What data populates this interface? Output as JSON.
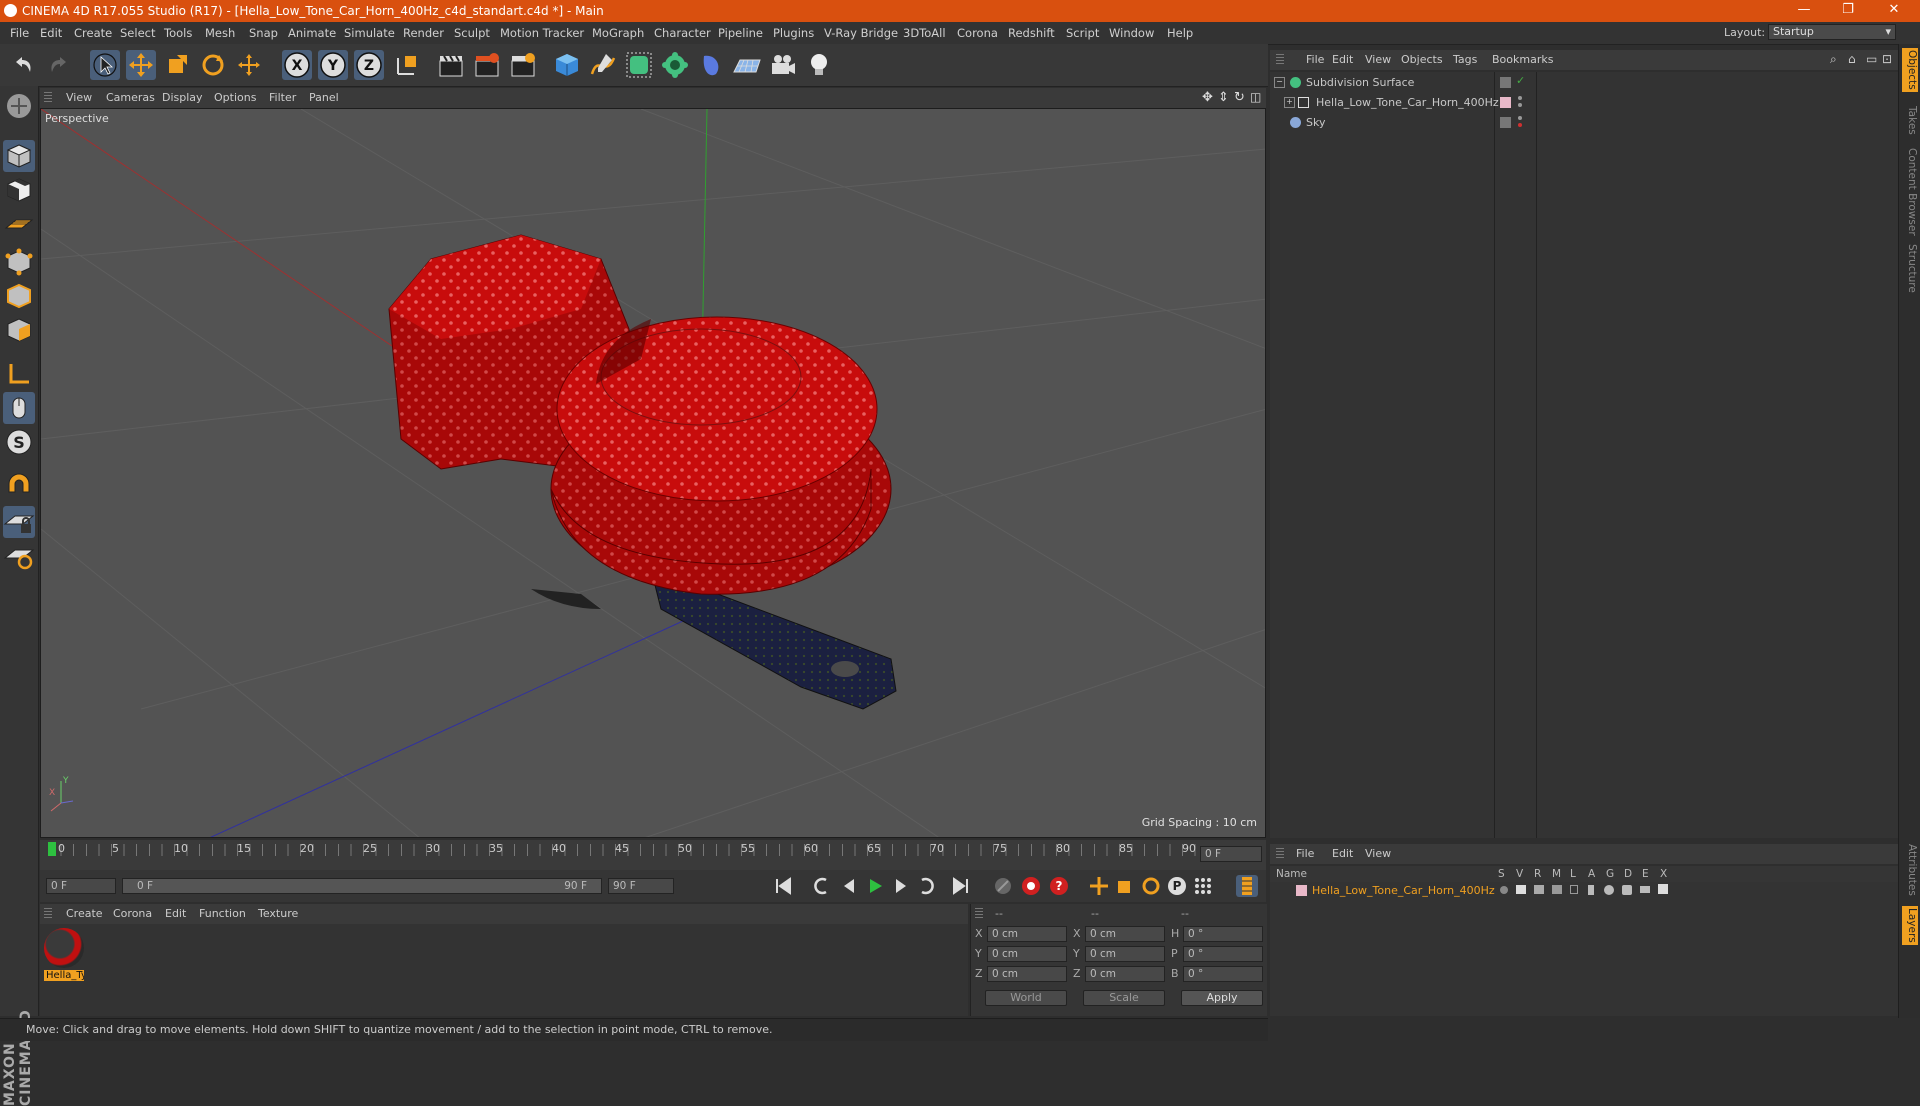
{
  "window": {
    "title": "CINEMA 4D R17.055 Studio (R17) - [Hella_Low_Tone_Car_Horn_400Hz_c4d_standart.c4d *] - Main",
    "minimize": "—",
    "maximize": "❐",
    "close": "✕"
  },
  "menubar": {
    "items": [
      "File",
      "Edit",
      "Create",
      "Select",
      "Tools",
      "Mesh",
      "Snap",
      "Animate",
      "Simulate",
      "Render",
      "Sculpt",
      "Motion Tracker",
      "MoGraph",
      "Character",
      "Pipeline",
      "Plugins",
      "V-Ray Bridge",
      "3DToAll",
      "Corona",
      "Redshift",
      "Script",
      "Window",
      "Help"
    ],
    "layout_label": "Layout:",
    "layout_value": "Startup"
  },
  "toolbar": {
    "axis_x": "X",
    "axis_y": "Y",
    "axis_z": "Z"
  },
  "viewport": {
    "menu": [
      "View",
      "Cameras",
      "Display",
      "Options",
      "Filter",
      "Panel"
    ],
    "name": "Perspective",
    "grid_spacing": "Grid Spacing : 10 cm"
  },
  "timeline": {
    "ticks": [
      "0",
      "5",
      "10",
      "15",
      "20",
      "25",
      "30",
      "35",
      "40",
      "45",
      "50",
      "55",
      "60",
      "65",
      "70",
      "75",
      "80",
      "85",
      "90"
    ],
    "current_frame": "0 F",
    "start_field": "0 F",
    "range_start": "0 F",
    "range_end": "90 F",
    "end_field": "90 F"
  },
  "materials": {
    "menu": [
      "Create",
      "Corona",
      "Edit",
      "Function",
      "Texture"
    ],
    "items": [
      {
        "label": "Hella_Ty"
      }
    ]
  },
  "coords": {
    "headers": [
      "--",
      "--",
      "--"
    ],
    "rows": [
      {
        "a": "X",
        "av": "0 cm",
        "b": "X",
        "bv": "0 cm",
        "c": "H",
        "cv": "0 °"
      },
      {
        "a": "Y",
        "av": "0 cm",
        "b": "Y",
        "bv": "0 cm",
        "c": "P",
        "cv": "0 °"
      },
      {
        "a": "Z",
        "av": "0 cm",
        "b": "Z",
        "bv": "0 cm",
        "c": "B",
        "cv": "0 °"
      }
    ],
    "world": "World",
    "scale": "Scale",
    "apply": "Apply"
  },
  "status": "Move: Click and drag to move elements. Hold down SHIFT to quantize movement / add to the selection in point mode, CTRL to remove.",
  "objects": {
    "menu": [
      "File",
      "Edit",
      "View",
      "Objects",
      "Tags",
      "Bookmarks"
    ],
    "rows": [
      {
        "name": "Subdivision Surface"
      },
      {
        "name": "Hella_Low_Tone_Car_Horn_400Hz"
      },
      {
        "name": "Sky"
      }
    ]
  },
  "layers": {
    "menu": [
      "File",
      "Edit",
      "View"
    ],
    "headers": [
      "Name",
      "S",
      "V",
      "R",
      "M",
      "L",
      "A",
      "G",
      "D",
      "E",
      "X"
    ],
    "rows": [
      {
        "name": "Hella_Low_Tone_Car_Horn_400Hz"
      }
    ]
  },
  "right_tabs": [
    "Objects",
    "Takes",
    "Content Browser",
    "Structure",
    "Attributes",
    "Layers"
  ],
  "colors": {
    "title_bar": "#d9500f",
    "accent_orange": "#f0a020",
    "horn_red": "#d21010",
    "bracket": "#1b2040"
  }
}
